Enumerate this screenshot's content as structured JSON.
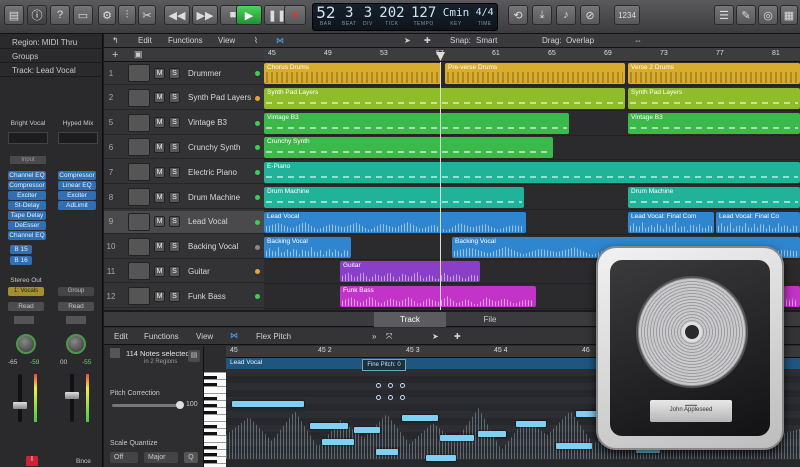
{
  "lcd": {
    "bar": "52",
    "beat": "3",
    "div": "3",
    "tick": "202",
    "bar_label": "BAR",
    "beat_label": "BEAT",
    "div_label": "DIV",
    "tick_label": "TICK",
    "tempo": "127",
    "tempo_label": "TEMPO",
    "key": "Cmin",
    "key_label": "KEY",
    "sig": "4/4",
    "sig_label": "TIME"
  },
  "toolbar": {
    "count_in": "1234"
  },
  "inspector": {
    "region": "Region: MIDI Thru",
    "groups": "Groups",
    "track": "Track: Lead Vocal",
    "patch_left": "Bright Vocal",
    "patch_right": "Hyped Mix",
    "input": "Input",
    "plugins_left": [
      "Channel EQ",
      "Compressor",
      "Exciter",
      "St-Delay",
      "Tape Delay",
      "DeEsser",
      "Channel EQ"
    ],
    "plugins_right": [
      "Compressor",
      "Linear EQ",
      "Exciter",
      "AdLimit"
    ],
    "bus_a": "B 15",
    "bus_b": "B 16",
    "out_left": "Stereo Out",
    "out_left_sub": "1: Vocals",
    "out_right": "Group",
    "read_left": "Read",
    "read_right": "Read",
    "val_l1": "-65",
    "val_l2": "-59",
    "val_r1": "00",
    "val_r2": "-55",
    "bottom_left": "I",
    "bottom_right": "Bnce"
  },
  "menus": {
    "edit": "Edit",
    "functions": "Functions",
    "view": "View",
    "snap_label": "Snap:",
    "snap": "Smart",
    "drag_label": "Drag:",
    "drag": "Overlap"
  },
  "ruler": [
    "45",
    "49",
    "53",
    "57",
    "61",
    "65",
    "69",
    "73",
    "77",
    "81"
  ],
  "tracks": [
    {
      "num": "1",
      "name": "Drummer"
    },
    {
      "num": "2",
      "name": "Synth Pad Layers"
    },
    {
      "num": "5",
      "name": "Vintage B3"
    },
    {
      "num": "6",
      "name": "Crunchy Synth"
    },
    {
      "num": "7",
      "name": "Electric Piano"
    },
    {
      "num": "8",
      "name": "Drum Machine"
    },
    {
      "num": "9",
      "name": "Lead Vocal"
    },
    {
      "num": "10",
      "name": "Backing Vocal"
    },
    {
      "num": "11",
      "name": "Guitar"
    },
    {
      "num": "12",
      "name": "Funk Bass"
    }
  ],
  "regions": {
    "chorus_drums": "Chorus Drums",
    "preverse_drums": "Pre-verse Drums",
    "verse2_drums": "Verse 2 Drums",
    "synth_pad": "Synth Pad Layers",
    "synth_pad_2": "Synth Pad Layers",
    "vintage_b3": "Vintage B3",
    "vintage_b3_2": "Vintage B3",
    "crunchy": "Crunchy Synth",
    "epiano": "E-Piano",
    "drum_machine": "Drum Machine",
    "drum_machine_2": "Drum Machine",
    "lead_vocal": "Lead Vocal",
    "lead_final_1": "Lead Vocal: Final Com",
    "lead_final_2": "Lead Vocal: Final Co",
    "backing_1": "Backing Vocal",
    "backing_2": "Backing Vocal",
    "guitar": "Guitar",
    "funk_bass": "Funk Bass"
  },
  "editor": {
    "tab_track": "Track",
    "tab_file": "File",
    "edit": "Edit",
    "functions": "Functions",
    "view": "View",
    "mode": "Flex Pitch",
    "notes_selected": "114 Notes selected",
    "in_regions": "in 2 Regions",
    "pitch_correction": "Pitch Correction",
    "pitch_value": "100",
    "scale_quantize": "Scale Quantize",
    "sq_off": "Off",
    "sq_major": "Major",
    "sq_q": "Q",
    "ruler": [
      "45",
      "45 2",
      "45 3",
      "45 4",
      "46"
    ],
    "region_name": "Lead Vocal",
    "fine_pitch": "Fine Pitch: 0"
  },
  "logo": {
    "plate": "John Appleseed"
  },
  "colors": {
    "yellow": "#d9ad2b",
    "lime": "#8fbd2a",
    "green": "#3bb94a",
    "teal": "#21b39a",
    "blue": "#2f86cf",
    "purple": "#8a3fc9",
    "magenta": "#c233c7"
  }
}
